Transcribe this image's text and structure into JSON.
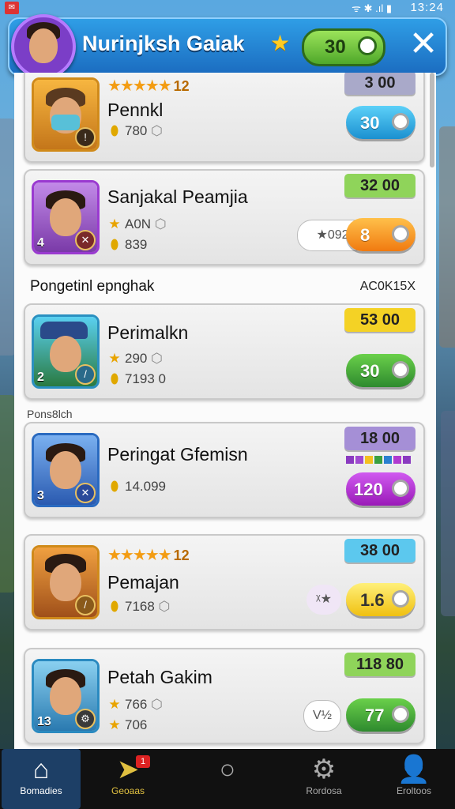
{
  "status": {
    "time": "13:24",
    "icons": "ᯤ ✱ .ıl ▮"
  },
  "header": {
    "title": "Nurinjksh Gaiak",
    "coins": "30",
    "close": "✕"
  },
  "cards": [
    {
      "name": "Pennkl",
      "stars": "★★★★★",
      "star_count": "12",
      "stat1": "",
      "stat2": "780",
      "tag": "3 00",
      "tag_color": "#a9a9c9",
      "button": "30",
      "button_color": "#2ba6e0",
      "level": "",
      "side": ""
    },
    {
      "name": "Sanjakal Peamjia",
      "stars": "",
      "star_count": "",
      "stat1": "A0N",
      "stat2": "839",
      "tag": "32 00",
      "tag_color": "#8fd45a",
      "button": "8",
      "button_color": "#f08a10",
      "level": "4",
      "side": "★092"
    },
    {
      "name": "Perimalkn",
      "stars": "",
      "star_count": "",
      "stat1": "290",
      "stat2": "7193 0",
      "tag": "53 00",
      "tag_color": "#f4d225",
      "button": "30",
      "button_color": "#3aa23a",
      "level": "2",
      "side": ""
    },
    {
      "name": "Peringat Gfemisn",
      "stars": "",
      "star_count": "",
      "stat1": "",
      "stat2": "14.099",
      "tag": "18 00",
      "tag_color": "#a58fd6",
      "button": "120",
      "button_color": "#b43ad0",
      "level": "3",
      "side": ""
    },
    {
      "name": "Pemajan",
      "stars": "★★★★★",
      "star_count": "12",
      "stat1": "",
      "stat2": "7168",
      "tag": "38 00",
      "tag_color": "#5cc8ee",
      "button": "1.6",
      "button_color": "#f4d225",
      "level": "",
      "side": "ᵡ★"
    },
    {
      "name": "Petah Gakim",
      "stars": "",
      "star_count": "",
      "stat1": "766",
      "stat2": "706",
      "tag": "118 80",
      "tag_color": "#8fd45a",
      "button": "77",
      "button_color": "#3aa23a",
      "level": "13",
      "side": "V½"
    }
  ],
  "sections": {
    "s1": "Pongetinl epnghak",
    "s1_right": "AC0K15X",
    "s2": "Pons8lch"
  },
  "nav": [
    "Bomadies",
    "Geoaas",
    "",
    "Rordosa",
    "Eroltoos"
  ],
  "nav_badge": "1",
  "colors": {
    "accent": "#1b6cc0",
    "panel": "#fbfbfb"
  }
}
